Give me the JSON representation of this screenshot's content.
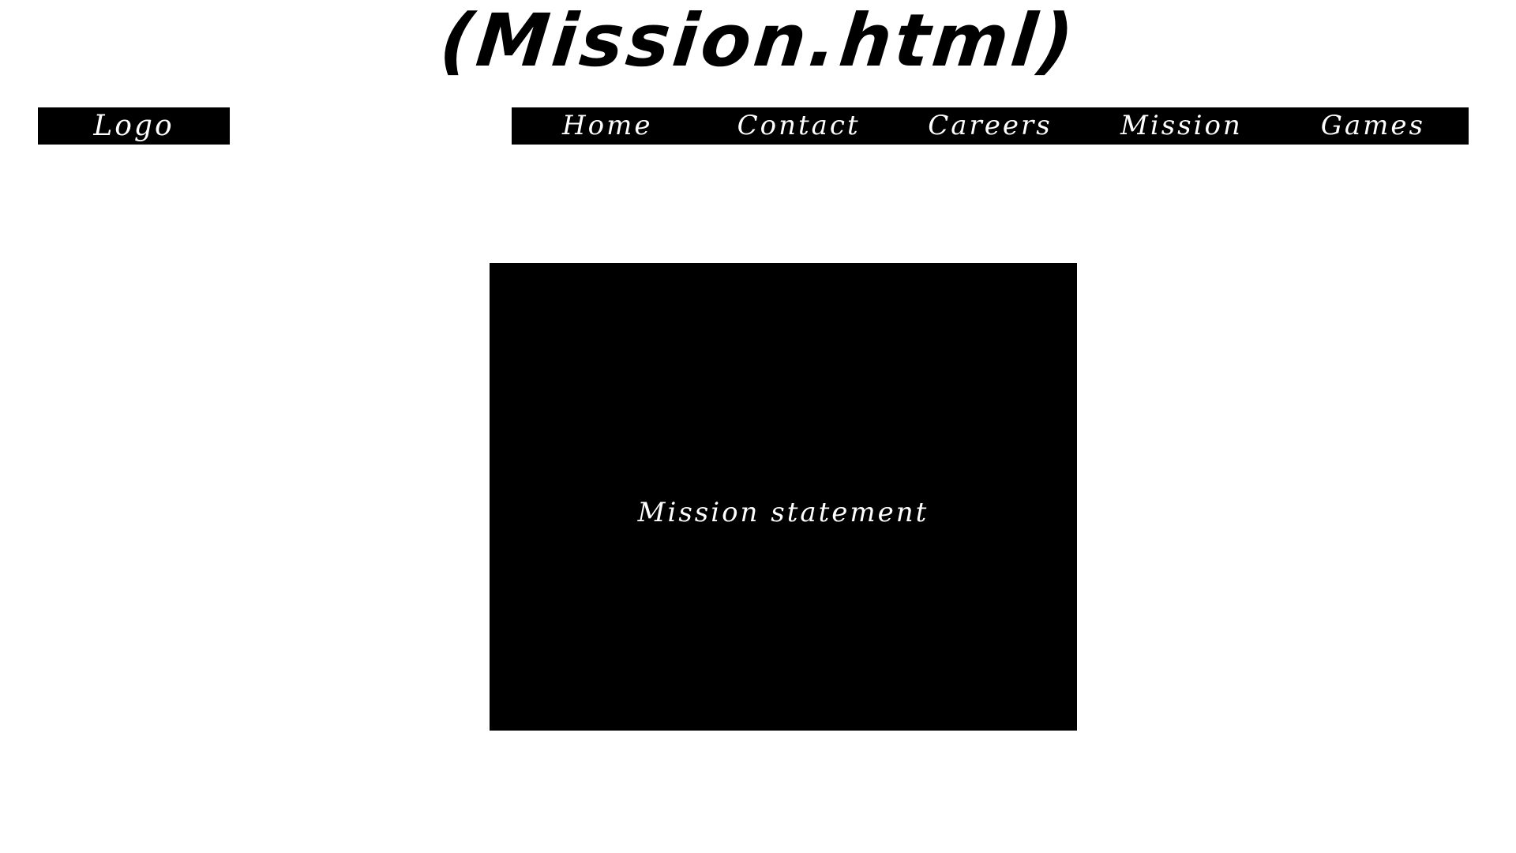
{
  "page": {
    "title": "(Mission.html)"
  },
  "logo": {
    "label": "Logo"
  },
  "nav": {
    "items": [
      {
        "label": "Home"
      },
      {
        "label": "Contact"
      },
      {
        "label": "Careers"
      },
      {
        "label": "Mission"
      },
      {
        "label": "Games"
      }
    ]
  },
  "main": {
    "mission_text": "Mission statement"
  },
  "colors": {
    "background": "#ffffff",
    "blocks": "#000000",
    "block_text": "#ffffff"
  }
}
